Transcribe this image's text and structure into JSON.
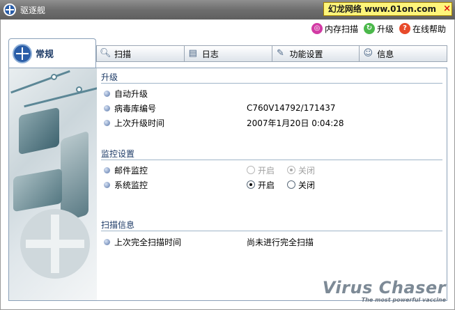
{
  "window": {
    "title": "驱逐舰",
    "watermark": "幻龙网络 www.01on.com",
    "close_symbol": "×"
  },
  "toolbar": {
    "links": [
      {
        "label": "内存扫描",
        "icon": "memory-scan-icon"
      },
      {
        "label": "升级",
        "icon": "upgrade-icon"
      },
      {
        "label": "在线帮助",
        "icon": "help-icon"
      }
    ]
  },
  "tabs": {
    "active": {
      "label": "常规",
      "icon": "general-icon"
    },
    "items": [
      {
        "label": "扫描",
        "icon": "magnifier-icon"
      },
      {
        "label": "日志",
        "icon": "notebook-icon"
      },
      {
        "label": "功能设置",
        "icon": "wrench-icon"
      },
      {
        "label": "信息",
        "icon": "person-icon"
      }
    ]
  },
  "sections": {
    "upgrade": {
      "title": "升级",
      "rows": [
        {
          "label": "自动升级",
          "value": ""
        },
        {
          "label": "病毒库编号",
          "value": "C760V14792/171437"
        },
        {
          "label": "上次升级时间",
          "value": "2007年1月20日 0:04:28"
        }
      ]
    },
    "monitor": {
      "title": "监控设置",
      "mail": {
        "label": "邮件监控",
        "on": "开启",
        "off": "关闭",
        "selected": "off",
        "disabled": true
      },
      "system": {
        "label": "系统监控",
        "on": "开启",
        "off": "关闭",
        "selected": "on",
        "disabled": false
      }
    },
    "scan_info": {
      "title": "扫描信息",
      "rows": [
        {
          "label": "上次完全扫描时间",
          "value": "尚未进行完全扫描"
        }
      ]
    }
  },
  "brand": {
    "name": "Virus Chaser",
    "tagline": "The most powerful vaccine"
  },
  "colors": {
    "titlebar": "#6e6e6e",
    "accent": "#1c3a66",
    "section_line": "#9fb4c8"
  }
}
